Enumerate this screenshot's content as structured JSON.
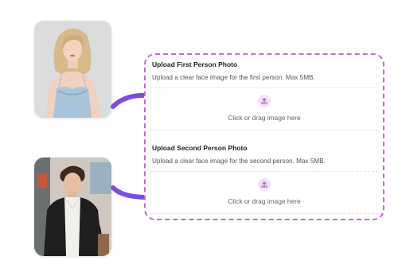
{
  "upload_panel": {
    "sections": [
      {
        "title": "Upload First Person Photo",
        "description": "Upload a clear face image for the first person. Max 5MB.",
        "dropzone_text": "Click or drag image here"
      },
      {
        "title": "Upload Second Person Photo",
        "description": "Upload a clear face image for the second person. Max 5MB.",
        "dropzone_text": "Click or drag image here"
      }
    ],
    "border_color": "#c46bd6"
  },
  "colors": {
    "arrow": "#7a4fe0",
    "upload_icon_bg": "#f1e2f7",
    "upload_icon": "#a35ac2"
  },
  "icons": {
    "upload": "upload-icon",
    "arrow": "curved-arrow-right-icon"
  }
}
